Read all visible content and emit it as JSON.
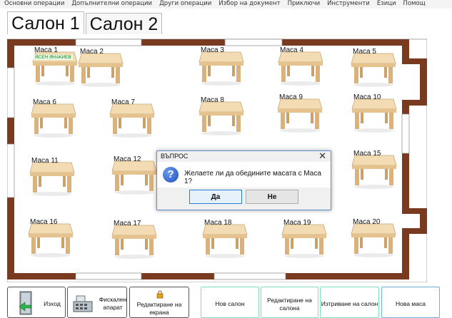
{
  "menu": [
    "Основни операции",
    "Допълнителни операции",
    "Други операции",
    "Избор на документ",
    "Приключи",
    "Инструменти",
    "Езици",
    "Помощ"
  ],
  "tabs": [
    {
      "label": "Салон 1"
    },
    {
      "label": "Салон 2"
    }
  ],
  "tables": [
    {
      "label": "Маса 1",
      "waiter": "ЯСЕН ЯНАКИЕВ"
    },
    {
      "label": "Маса 2"
    },
    {
      "label": "Маса 3"
    },
    {
      "label": "Маса 4"
    },
    {
      "label": "Маса 5"
    },
    {
      "label": "Маса 6"
    },
    {
      "label": "Маса 7"
    },
    {
      "label": "Маса 8"
    },
    {
      "label": "Маса 9"
    },
    {
      "label": "Маса 10"
    },
    {
      "label": "Маса 11"
    },
    {
      "label": "Маса 12"
    },
    {
      "label": "Маса 15"
    },
    {
      "label": "Маса 16"
    },
    {
      "label": "Маса 17"
    },
    {
      "label": "Маса 18"
    },
    {
      "label": "Маса 19"
    },
    {
      "label": "Маса 20"
    }
  ],
  "dialog": {
    "title": "ВЪПРОС",
    "close": "✕",
    "icon": "?",
    "message": "Желаете ли да обедините масата с Маса 1?",
    "yes": "Да",
    "no": "Не"
  },
  "bottom_buttons": {
    "exit": "Изход",
    "fiscal_1": "Фискален",
    "fiscal_2": "апарат",
    "edit_screen_1": "Редактиране на",
    "edit_screen_2": "екрана",
    "new_hall": "Нов салон",
    "edit_hall_1": "Редактиране на",
    "edit_hall_2": "салона",
    "delete_hall": "Изтриване на салон",
    "new_table": "Нова маса"
  },
  "colors": {
    "wall": "#7a3a1f",
    "table_top": "#f3dcb4",
    "table_leg": "#d9b27c",
    "dialog_border": "#5b8fd6",
    "accent_green": "#7fe0c0"
  }
}
